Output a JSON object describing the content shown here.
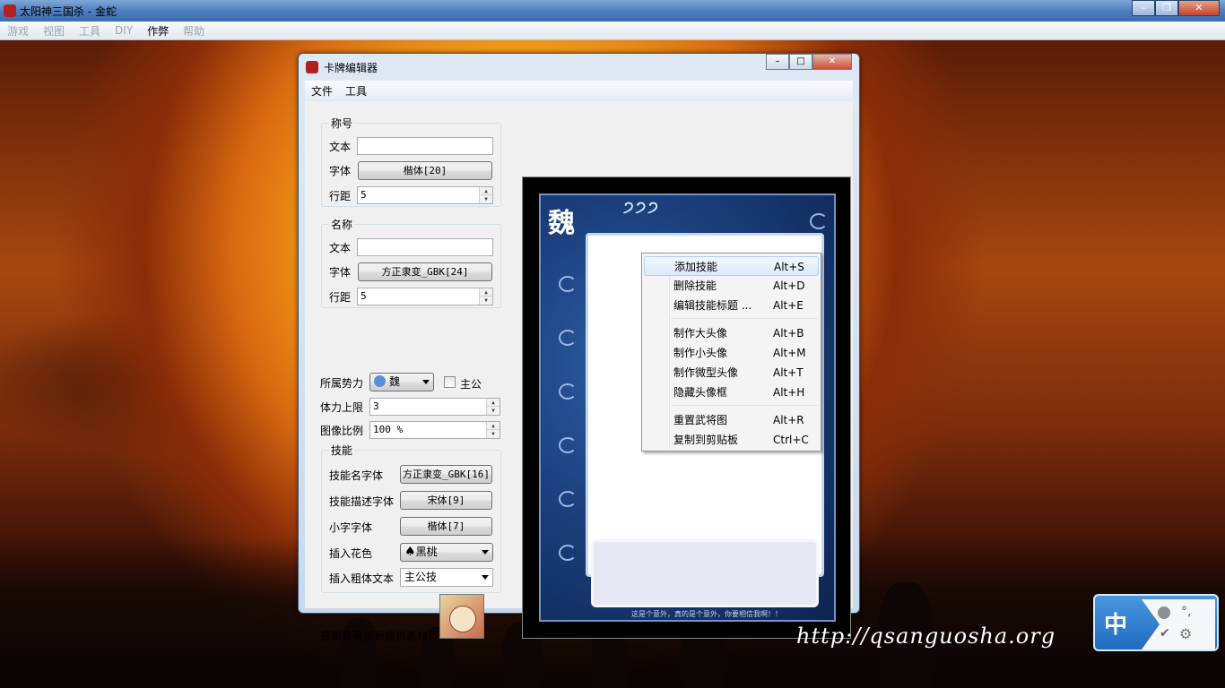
{
  "app": {
    "title": "太阳神三国杀 - 金蛇"
  },
  "main_menu": [
    "游戏",
    "视图",
    "工具",
    "DIY",
    "作弊",
    "帮助"
  ],
  "dialog": {
    "title": "卡牌编辑器",
    "menu": [
      "文件",
      "工具"
    ],
    "title_group": {
      "label": "称号",
      "text_label": "文本",
      "text_value": "",
      "font_label": "字体",
      "font_button": "楷体[20]",
      "spacing_label": "行距",
      "spacing_value": "5"
    },
    "name_group": {
      "label": "名称",
      "text_label": "文本",
      "text_value": "",
      "font_label": "字体",
      "font_button": "方正隶变_GBK[24]",
      "spacing_label": "行距",
      "spacing_value": "5"
    },
    "kingdom": {
      "label": "所属势力",
      "value": "魏",
      "lord_label": "主公"
    },
    "hp": {
      "label": "体力上限",
      "value": "3"
    },
    "scale": {
      "label": "图像比例",
      "value": "100 %"
    },
    "skills": {
      "label": "技能",
      "name_font_label": "技能名字体",
      "name_font_button": "方正隶变_GBK[16]",
      "desc_font_label": "技能描述字体",
      "desc_font_button": "宋体[9]",
      "small_font_label": "小字字体",
      "small_font_button": "楷体[7]",
      "suit_label": "插入花色",
      "suit_value": "黑桃",
      "bold_label": "插入粗体文本",
      "bold_value": "主公技"
    },
    "credit": "感谢背碗卤粉提供素材"
  },
  "card": {
    "faction_glyph": "魏",
    "hp_marks": "੭੭੭",
    "footer": "这是个意外，真的是个意外，你要相信我啊！！"
  },
  "context_menu": [
    {
      "label": "添加技能",
      "shortcut": "Alt+S"
    },
    {
      "label": "删除技能",
      "shortcut": "Alt+D"
    },
    {
      "label": "编辑技能标题 ...",
      "shortcut": "Alt+E"
    },
    {
      "label": "制作大头像",
      "shortcut": "Alt+B"
    },
    {
      "label": "制作小头像",
      "shortcut": "Alt+M"
    },
    {
      "label": "制作微型头像",
      "shortcut": "Alt+T"
    },
    {
      "label": "隐藏头像框",
      "shortcut": "Alt+H"
    },
    {
      "label": "重置武将图",
      "shortcut": "Alt+R"
    },
    {
      "label": "复制到剪贴板",
      "shortcut": "Ctrl+C"
    }
  ],
  "watermark": "http://qsanguosha.org",
  "ime": {
    "mode": "中",
    "punct": "°,"
  },
  "colors": {
    "accent": "#4f7fbf",
    "card_blue": "#1a3c78"
  }
}
